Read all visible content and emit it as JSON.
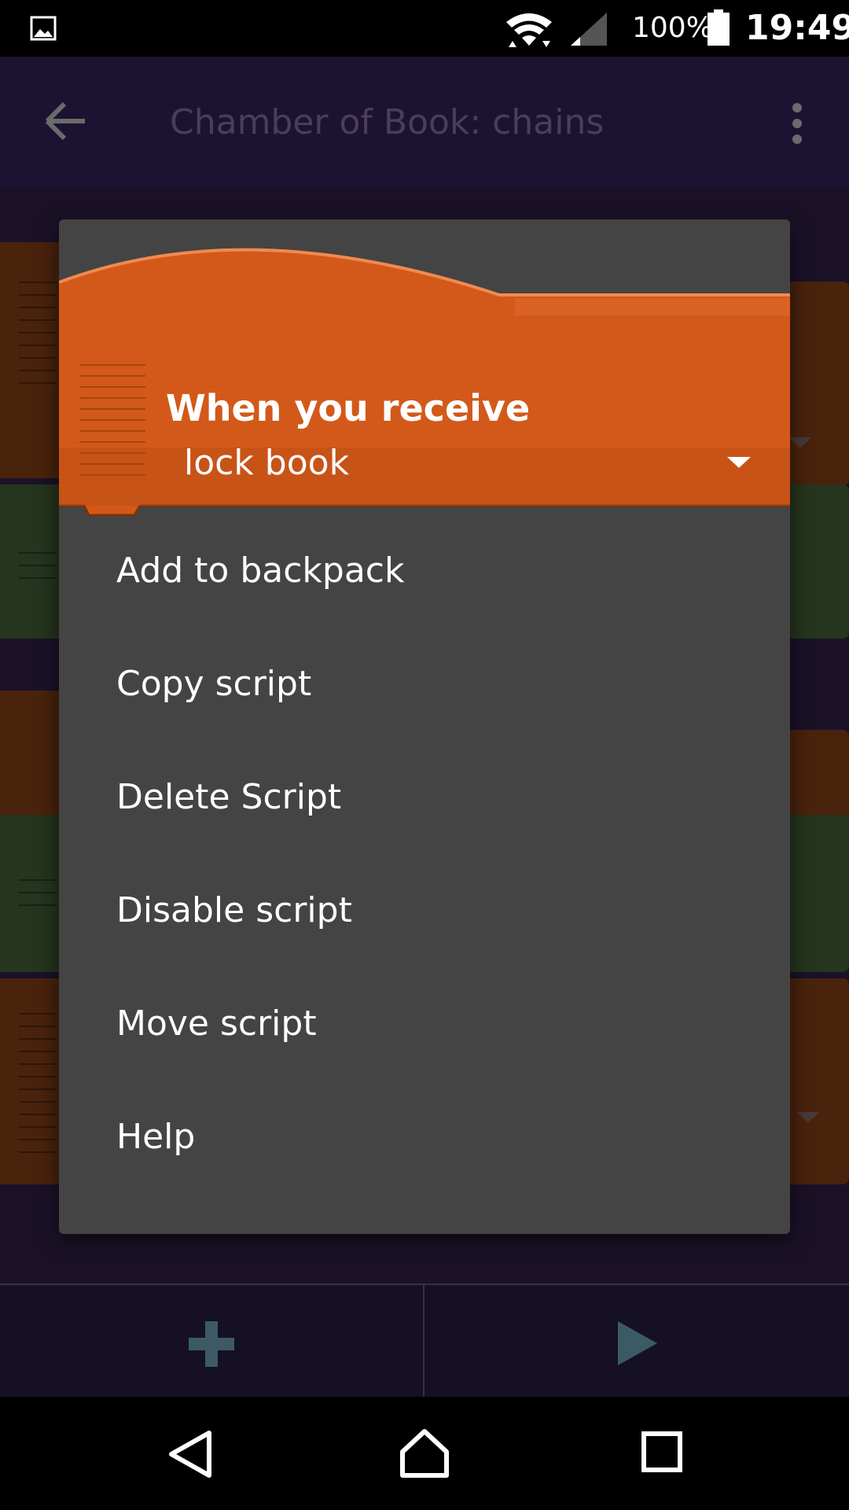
{
  "status_bar": {
    "battery_percent": "100%",
    "time": "19:49"
  },
  "app_bar": {
    "title": "Chamber of Book: chains"
  },
  "dialog": {
    "block": {
      "title": "When you receive",
      "message": "lock book",
      "color": "#d2591a"
    },
    "menu_items": [
      "Add to backpack",
      "Copy script",
      "Delete Script",
      "Disable script",
      "Move script",
      "Help"
    ]
  },
  "colors": {
    "event_brick": "#d2591a",
    "control_brick": "#5b8a3a",
    "dialog_bg": "#444444",
    "scrim": "rgba(0,0,0,0.6)",
    "toolbar_icon": "#3c5a66"
  },
  "icons": {
    "status": [
      "gallery-icon",
      "wifi-icon",
      "signal-icon",
      "battery-icon"
    ],
    "app_bar": [
      "back-arrow-icon",
      "overflow-menu-icon"
    ],
    "bottom_bar": [
      "add-icon",
      "play-icon"
    ],
    "nav_bar": [
      "nav-back-icon",
      "nav-home-icon",
      "nav-recent-icon"
    ]
  }
}
